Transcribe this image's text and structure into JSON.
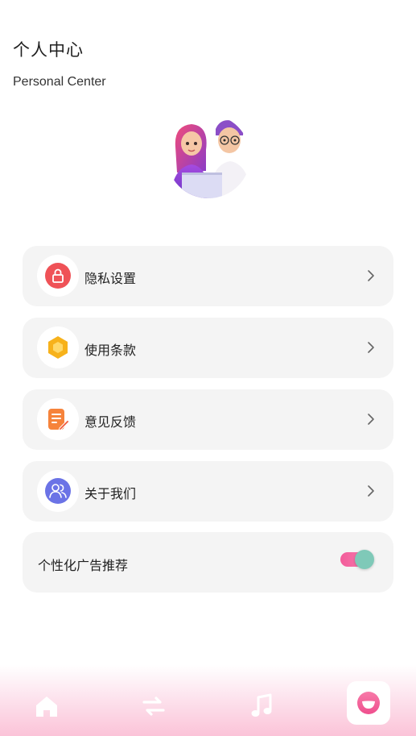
{
  "header": {
    "title": "个人中心",
    "subtitle": "Personal Center"
  },
  "menu": [
    {
      "label": "隐私设置",
      "icon": "lock-icon",
      "color": "#f05458"
    },
    {
      "label": "使用条款",
      "icon": "hexagon-icon",
      "color": "#f7b21b"
    },
    {
      "label": "意见反馈",
      "icon": "edit-document-icon",
      "color": "#f6833b"
    },
    {
      "label": "关于我们",
      "icon": "users-icon",
      "color": "#6b73e6"
    }
  ],
  "ad_toggle": {
    "label": "个性化广告推荐",
    "enabled": true
  },
  "tabbar": {
    "tabs": [
      {
        "icon": "home-icon",
        "active": false
      },
      {
        "icon": "transfer-icon",
        "active": false
      },
      {
        "icon": "music-note-icon",
        "active": false
      },
      {
        "icon": "profile-icon",
        "active": true
      }
    ],
    "accent": "#f35c9a"
  }
}
